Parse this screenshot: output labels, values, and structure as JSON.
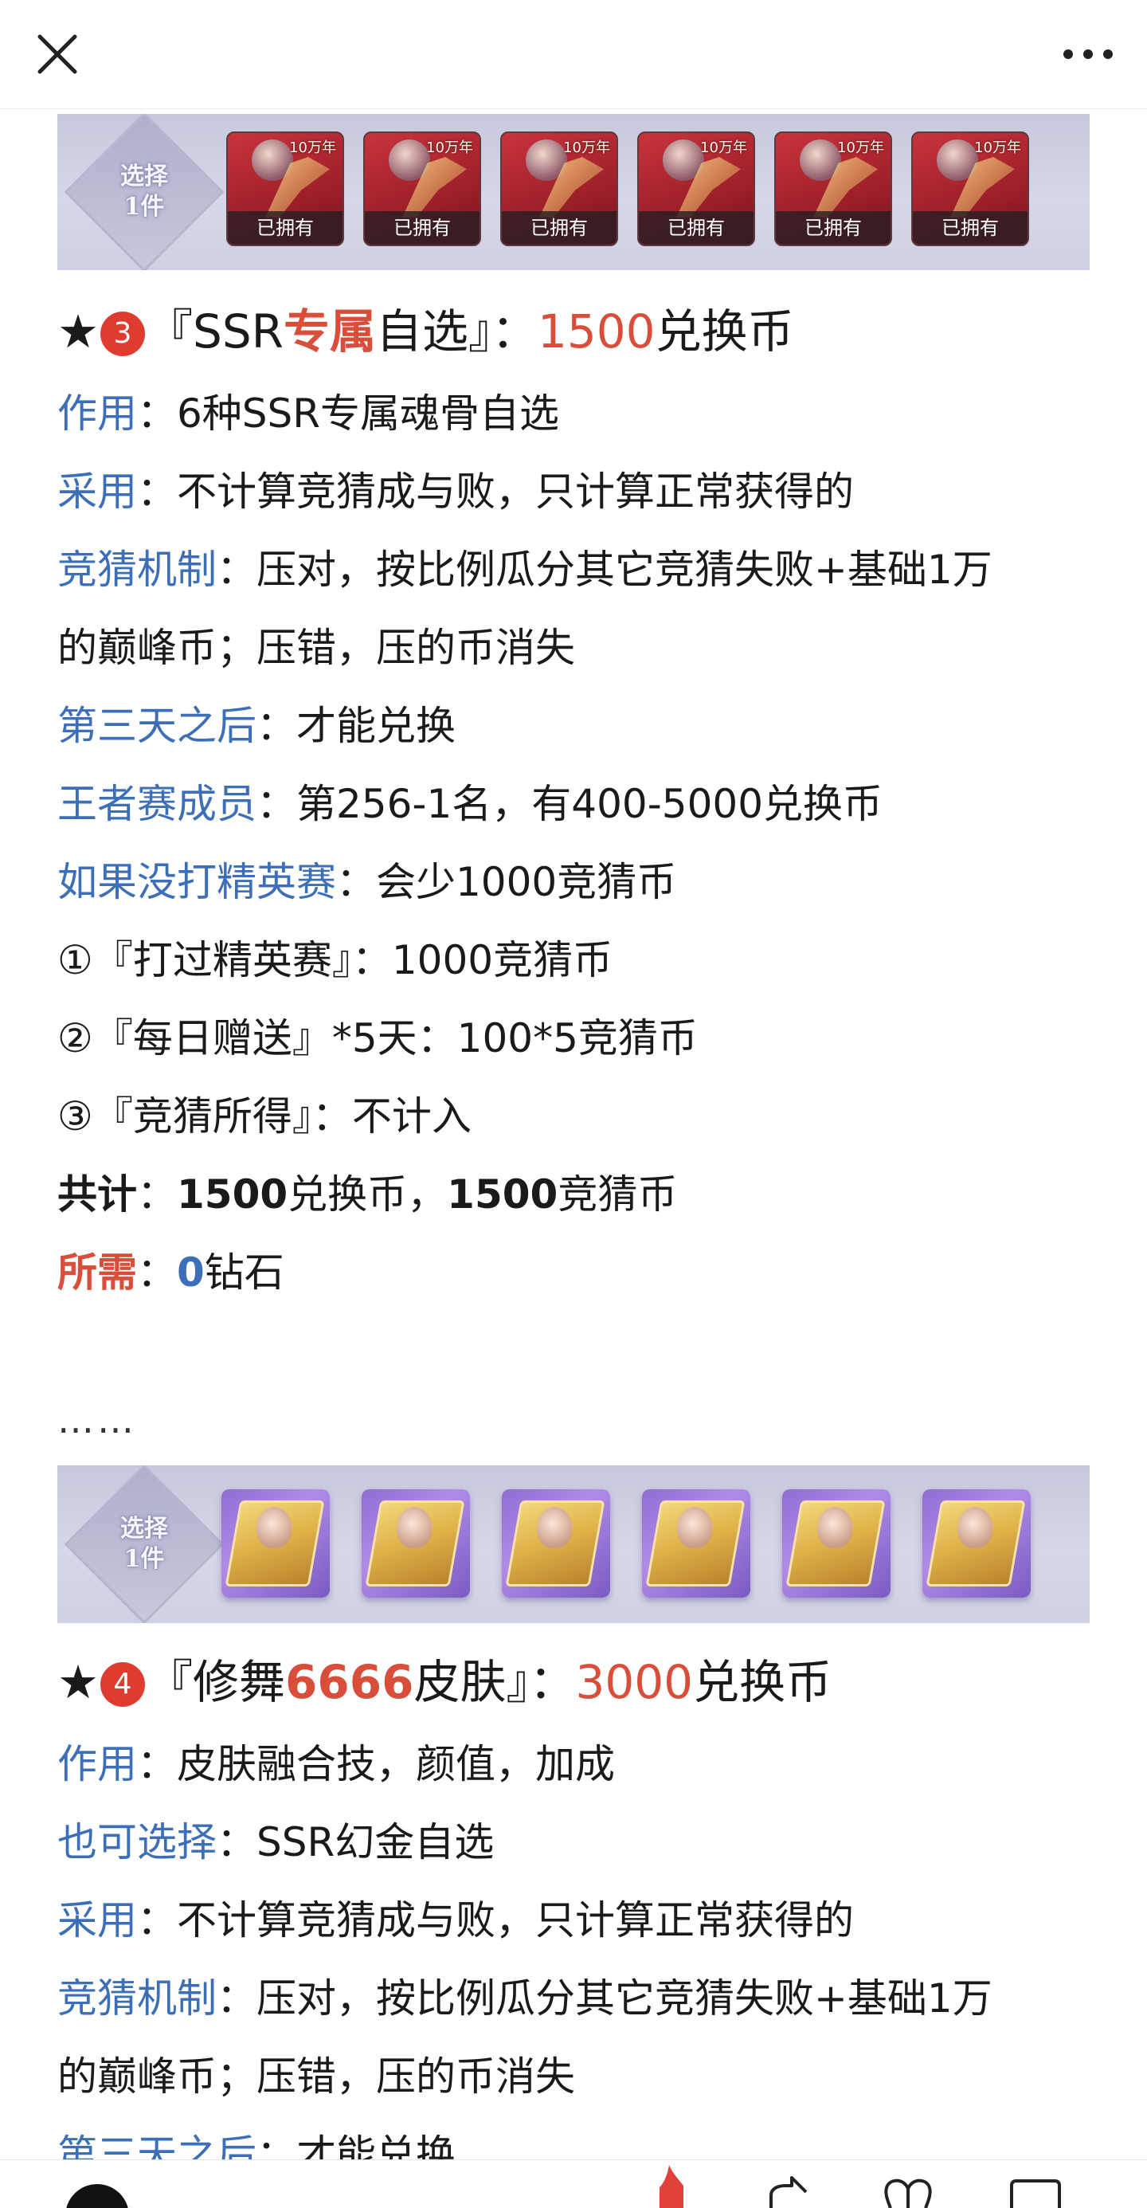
{
  "banner1": {
    "select_text": [
      "选择",
      "1件"
    ],
    "items": [
      {
        "age": "10万年",
        "owned": "已拥有"
      },
      {
        "age": "10万年",
        "owned": "已拥有"
      },
      {
        "age": "10万年",
        "owned": "已拥有"
      },
      {
        "age": "10万年",
        "owned": "已拥有"
      },
      {
        "age": "10万年",
        "owned": "已拥有"
      },
      {
        "age": "10万年",
        "owned": "已拥有"
      }
    ]
  },
  "section3": {
    "star": "★",
    "number": "3",
    "title_pre": "『SSR",
    "title_highlight": "专属",
    "title_post": "自选』：",
    "price": "1500",
    "price_unit": "兑换币",
    "rows": [
      {
        "label": "作用",
        "text": "：6种SSR专属魂骨自选"
      },
      {
        "label": "采用",
        "text": "：不计算竞猜成与败，只计算正常获得的"
      },
      {
        "label": "竞猜机制",
        "text": "：压对，按比例瓜分其它竞猜失败+基础1万"
      },
      {
        "label": "",
        "text": "的巅峰币；压错，压的币消失"
      },
      {
        "label": "第三天之后",
        "text": "：才能兑换"
      },
      {
        "label": "王者赛成员",
        "text": "：第256-1名，有400-5000兑换币"
      },
      {
        "label": "如果没打精英赛",
        "text": "：会少1000竞猜币"
      }
    ],
    "list": [
      "①『打过精英赛』：1000竞猜币",
      "②『每日赠送』*5天：100*5竞猜币",
      "③『竞猜所得』：不计入"
    ],
    "total_label": "共计",
    "total_sep": "：",
    "total_num1": "1500",
    "total_unit1": "兑换币，",
    "total_num2": "1500",
    "total_unit2": "竞猜币",
    "need_label": "所需",
    "need_sep": "：",
    "need_num": "0",
    "need_unit": "钻石"
  },
  "ellipsis": "……",
  "banner2": {
    "select_text": [
      "选择",
      "1件"
    ],
    "count": 6
  },
  "section4": {
    "star": "★",
    "number": "4",
    "title_pre": "『修舞",
    "title_highlight": "6666",
    "title_post": "皮肤』：",
    "price": "3000",
    "price_unit": "兑换币",
    "rows": [
      {
        "label": "作用",
        "text": "：皮肤融合技，颜值，加成"
      },
      {
        "label": "也可选择",
        "text": "：SSR幻金自选"
      },
      {
        "label": "采用",
        "text": "：不计算竞猜成与败，只计算正常获得的"
      },
      {
        "label": "竞猜机制",
        "text": "：压对，按比例瓜分其它竞猜失败+基础1万"
      },
      {
        "label": "",
        "text": "的巅峰币；压错，压的币消失"
      },
      {
        "label": "第三天之后",
        "text": "：才能兑换"
      }
    ]
  },
  "colors": {
    "blue": "#3d6fb8",
    "red": "#d94e3a",
    "circle": "#df3b30"
  },
  "icons": [
    "close-icon",
    "more-icon",
    "like-icon",
    "share-icon",
    "heart-icon",
    "comment-icon"
  ]
}
